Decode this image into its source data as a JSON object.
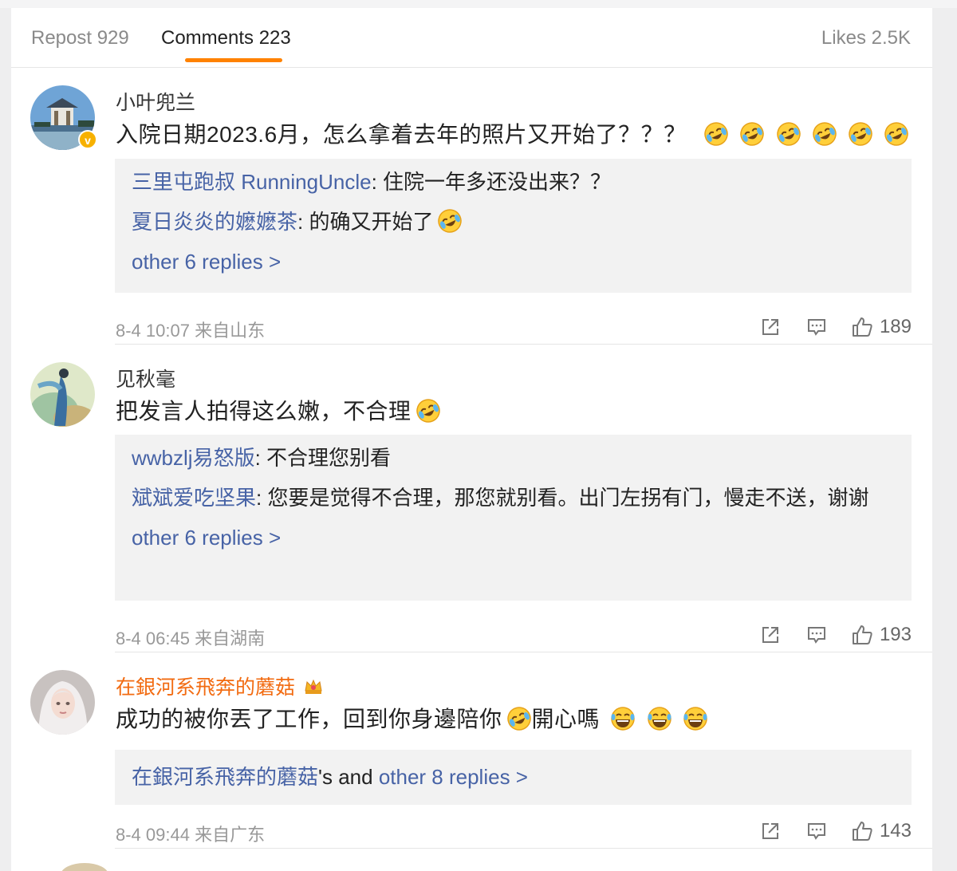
{
  "tabs": {
    "repost": "Repost 929",
    "comments": "Comments 223",
    "likes": "Likes 2.5K"
  },
  "accent": "#ff8200",
  "link_color": "#4763a6",
  "comments": [
    {
      "username": "小叶兜兰",
      "verified": true,
      "text": "入院日期2023.6月，怎么拿着去年的照片又开始了？？？",
      "emoji_count": 6,
      "replies": [
        {
          "user": "三里屯跑叔 RunningUncle",
          "text": ": 住院一年多还没出来？？"
        },
        {
          "user": "夏日炎炎的嬷嬷茶",
          "text": ": 的确又开始了"
        }
      ],
      "more": "other 6 replies >",
      "time": "8-4 10:07 来自山东",
      "likes": "189"
    },
    {
      "username": "见秋毫",
      "text": "把发言人拍得这么嫩，不合理",
      "emoji_count": 1,
      "replies": [
        {
          "user": "wwbzlj易怒版",
          "text": ": 不合理您别看"
        },
        {
          "user": "斌斌爱吃坚果",
          "text": ": 您要是觉得不合理，那您就别看。出门左拐有门，慢走不送，谢谢"
        }
      ],
      "more": "other 6 replies >",
      "time": "8-4 06:45 来自湖南",
      "likes": "193"
    },
    {
      "username": "在銀河系飛奔的蘑菇",
      "text_a": "成功的被你丟了工作，回到你身邊陪你",
      "text_b": "開心嗎",
      "reply_summary": {
        "user": "在銀河系飛奔的蘑菇",
        "mid": "'s and ",
        "more": "other 8 replies >"
      },
      "time": "8-4 09:44 来自广东",
      "likes": "143"
    }
  ],
  "icons": [
    "share-icon",
    "comment-icon",
    "like-icon",
    "laugh-cry-emoji",
    "laugh-emoji",
    "crown-icon",
    "verified-badge-icon"
  ]
}
